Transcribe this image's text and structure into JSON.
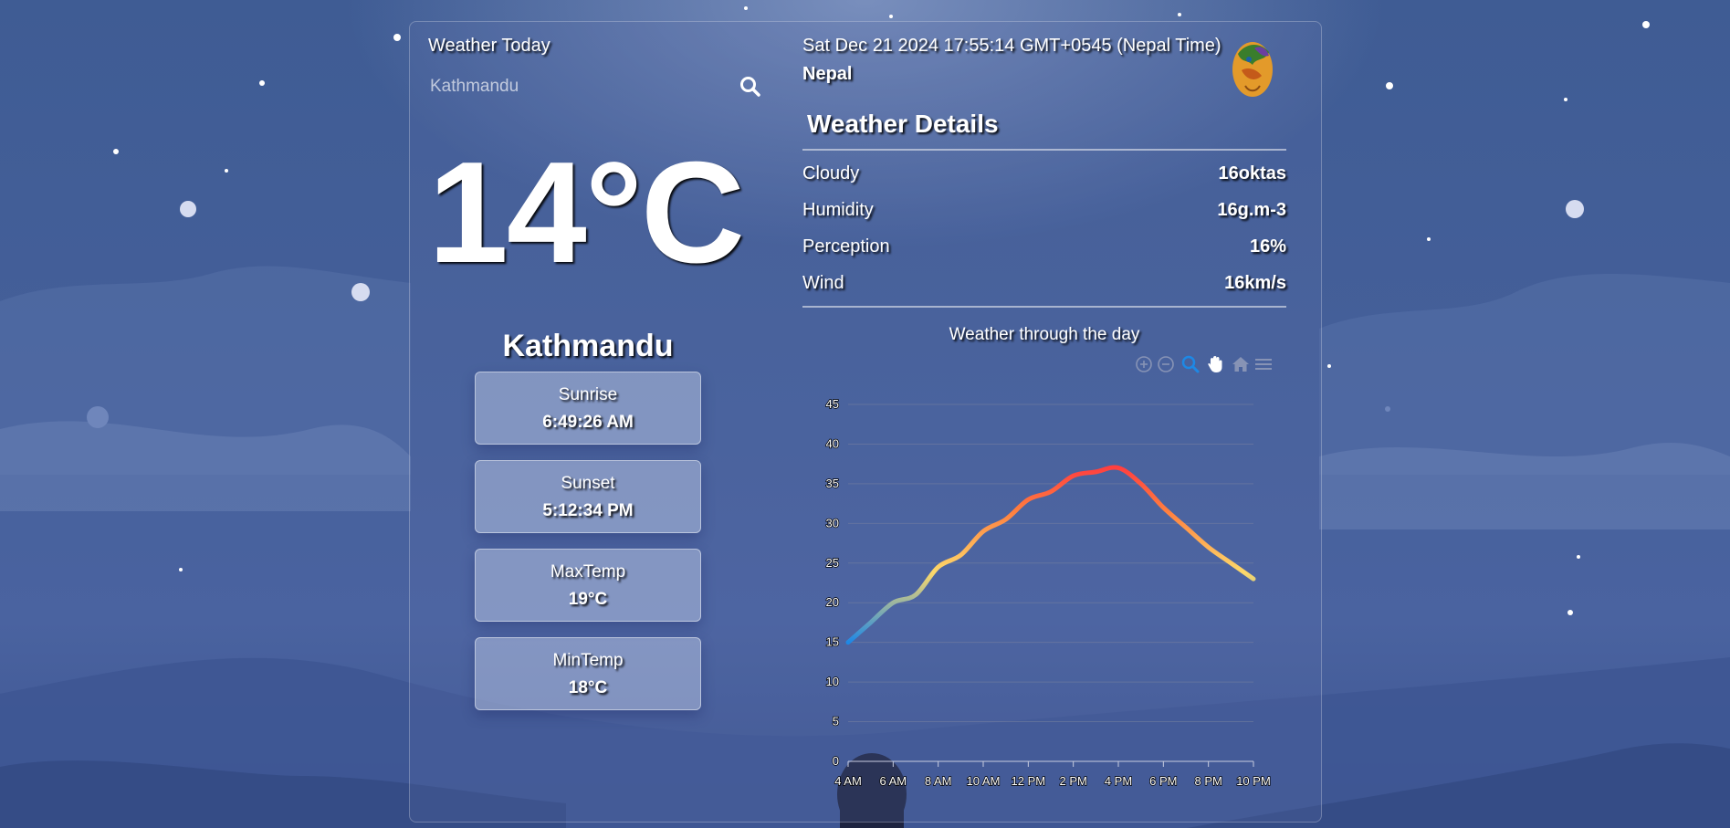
{
  "app": {
    "title": "Weather Today"
  },
  "search": {
    "placeholder": "Kathmandu",
    "value": ""
  },
  "current": {
    "temperature": "14°C",
    "city": "Kathmandu"
  },
  "cards": [
    {
      "label": "Sunrise",
      "value": "6:49:26 AM"
    },
    {
      "label": "Sunset",
      "value": "5:12:34 PM"
    },
    {
      "label": "MaxTemp",
      "value": "19°C"
    },
    {
      "label": "MinTemp",
      "value": "18°C"
    }
  ],
  "header": {
    "datetime": "Sat Dec 21 2024 17:55:14 GMT+0545 (Nepal Time)",
    "country": "Nepal"
  },
  "details": {
    "title": "Weather Details",
    "rows": [
      {
        "label": "Cloudy",
        "value": "16oktas"
      },
      {
        "label": "Humidity",
        "value": "16g.m-3"
      },
      {
        "label": "Perception",
        "value": "16%"
      },
      {
        "label": "Wind",
        "value": "16km/s"
      }
    ]
  },
  "toolbar": {
    "icons": [
      "zoom-in-icon",
      "zoom-out-icon",
      "zoom-select-icon",
      "pan-hand-icon",
      "home-reset-icon",
      "menu-icon"
    ],
    "active": "zoom-select-icon",
    "active_color": "#1e88e5"
  },
  "chart_data": {
    "type": "line",
    "title": "Weather through the day",
    "categories": [
      "4 AM",
      "6 AM",
      "8 AM",
      "10 AM",
      "12 PM",
      "2 PM",
      "4 PM",
      "6 PM",
      "8 PM",
      "10 PM"
    ],
    "x_hours": [
      4,
      5,
      6,
      7,
      8,
      9,
      10,
      11,
      12,
      13,
      14,
      15,
      16,
      17,
      18,
      19,
      20,
      21,
      22
    ],
    "series": [
      {
        "values": [
          15,
          17.5,
          20,
          21,
          24.5,
          26,
          29,
          30.5,
          33,
          34,
          36,
          36.5,
          37,
          35,
          32,
          29.5,
          27,
          25,
          23
        ]
      }
    ],
    "ylim": [
      0,
      45
    ],
    "yticks": [
      0,
      5,
      10,
      15,
      20,
      25,
      30,
      35,
      40,
      45
    ],
    "gradient_colors": [
      "#1e88e5",
      "#fdd96a",
      "#ff7f3f",
      "#ff3f3f"
    ],
    "grid": true,
    "legend": "none"
  }
}
